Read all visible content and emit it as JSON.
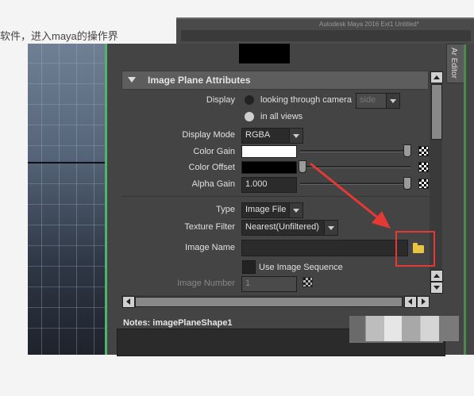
{
  "caption": "软件，进入maya的操作界",
  "background_window": {
    "title": "Autodesk Maya 2016 Ext1 Untitled*"
  },
  "editor_tab": {
    "label": "Ar Editor"
  },
  "section": {
    "title": "Image Plane Attributes"
  },
  "display": {
    "label": "Display",
    "option_camera": "looking through camera",
    "camera_value": "side",
    "option_all_views": "in all views",
    "selected": "in all views"
  },
  "display_mode": {
    "label": "Display Mode",
    "value": "RGBA"
  },
  "color_gain": {
    "label": "Color Gain",
    "color": "#ffffff",
    "slider": 1.0
  },
  "color_offset": {
    "label": "Color Offset",
    "color": "#000000",
    "slider": 0.0
  },
  "alpha_gain": {
    "label": "Alpha Gain",
    "value": "1.000",
    "slider": 1.0
  },
  "type": {
    "label": "Type",
    "value": "Image File"
  },
  "texture_filter": {
    "label": "Texture Filter",
    "value": "Nearest(Unfiltered)"
  },
  "image_name": {
    "label": "Image Name",
    "value": ""
  },
  "use_image_sequence": {
    "label": "Use Image Sequence",
    "checked": false
  },
  "image_number": {
    "label": "Image Number",
    "value": "1"
  },
  "notes": {
    "label": "Notes:  imagePlaneShape1",
    "value": ""
  },
  "colors": {
    "panel_bg": "#444444",
    "highlight": "#e53935",
    "accent_green": "#4fb56c",
    "folder": "#e8c440"
  },
  "icons": [
    "folder-icon",
    "checker-icon",
    "collapse-triangle-icon",
    "scroll-up-icon",
    "scroll-down-icon",
    "scroll-left-icon",
    "scroll-right-icon",
    "red-arrow-annotation"
  ]
}
